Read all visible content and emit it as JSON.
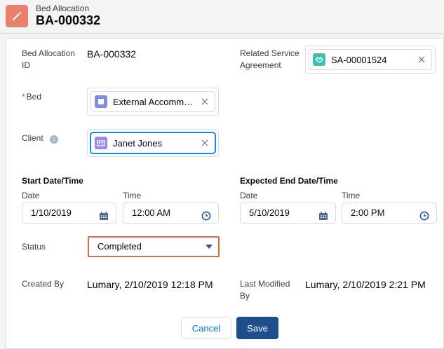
{
  "header": {
    "object_label": "Bed Allocation",
    "record_name": "BA-000332"
  },
  "fields": {
    "bed_allocation_id": {
      "label_line1": "Bed Allocation",
      "label_line2": "ID",
      "value": "BA-000332"
    },
    "related_service_agreement": {
      "label_line1": "Related Service",
      "label_line2": "Agreement",
      "value": "SA-00001524"
    },
    "bed": {
      "required_mark": "*",
      "label": "Bed",
      "value": "External Accomm…"
    },
    "client": {
      "label": "Client",
      "info_icon": "info-icon",
      "value": "Janet Jones"
    },
    "start": {
      "section": "Start Date/Time",
      "date_label": "Date",
      "date_value": "1/10/2019",
      "time_label": "Time",
      "time_value": "12:00 AM"
    },
    "end": {
      "section": "Expected End Date/Time",
      "date_label": "Date",
      "date_value": "5/10/2019",
      "time_label": "Time",
      "time_value": "2:00 PM"
    },
    "status": {
      "label": "Status",
      "value": "Completed"
    },
    "created_by": {
      "label": "Created By",
      "value": "Lumary, 2/10/2019 12:18 PM"
    },
    "last_modified_by": {
      "label_line1": "Last Modified",
      "label_line2": "By",
      "value": "Lumary, 2/10/2019 2:21 PM"
    }
  },
  "buttons": {
    "cancel": "Cancel",
    "save": "Save"
  },
  "colors": {
    "header_icon_bg": "#e9826c",
    "service_agreement_icon": "#3bbfb1",
    "bed_icon": "#7f8de1",
    "client_icon": "#9c89e6",
    "status_highlight": "#e0693f",
    "save_button": "#1f4e8c"
  }
}
